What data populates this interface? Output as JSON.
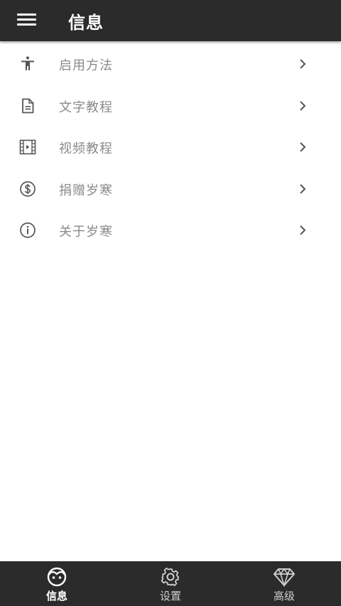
{
  "header": {
    "title": "信息",
    "menu_icon": "hamburger-menu-icon"
  },
  "list": {
    "items": [
      {
        "label": "启用方法",
        "icon": "accessibility-icon"
      },
      {
        "label": "文字教程",
        "icon": "document-icon"
      },
      {
        "label": "视频教程",
        "icon": "video-film-icon"
      },
      {
        "label": "捐赠岁寒",
        "icon": "dollar-coin-icon"
      },
      {
        "label": "关于岁寒",
        "icon": "info-icon"
      }
    ]
  },
  "bottom_nav": {
    "items": [
      {
        "label": "信息",
        "icon": "face-icon",
        "active": true
      },
      {
        "label": "设置",
        "icon": "gear-icon",
        "active": false
      },
      {
        "label": "高级",
        "icon": "diamond-icon",
        "active": false
      }
    ]
  },
  "colors": {
    "bar_background": "#2b2b2b",
    "label_text": "#8a8a8a",
    "icon_gray": "#555555"
  }
}
